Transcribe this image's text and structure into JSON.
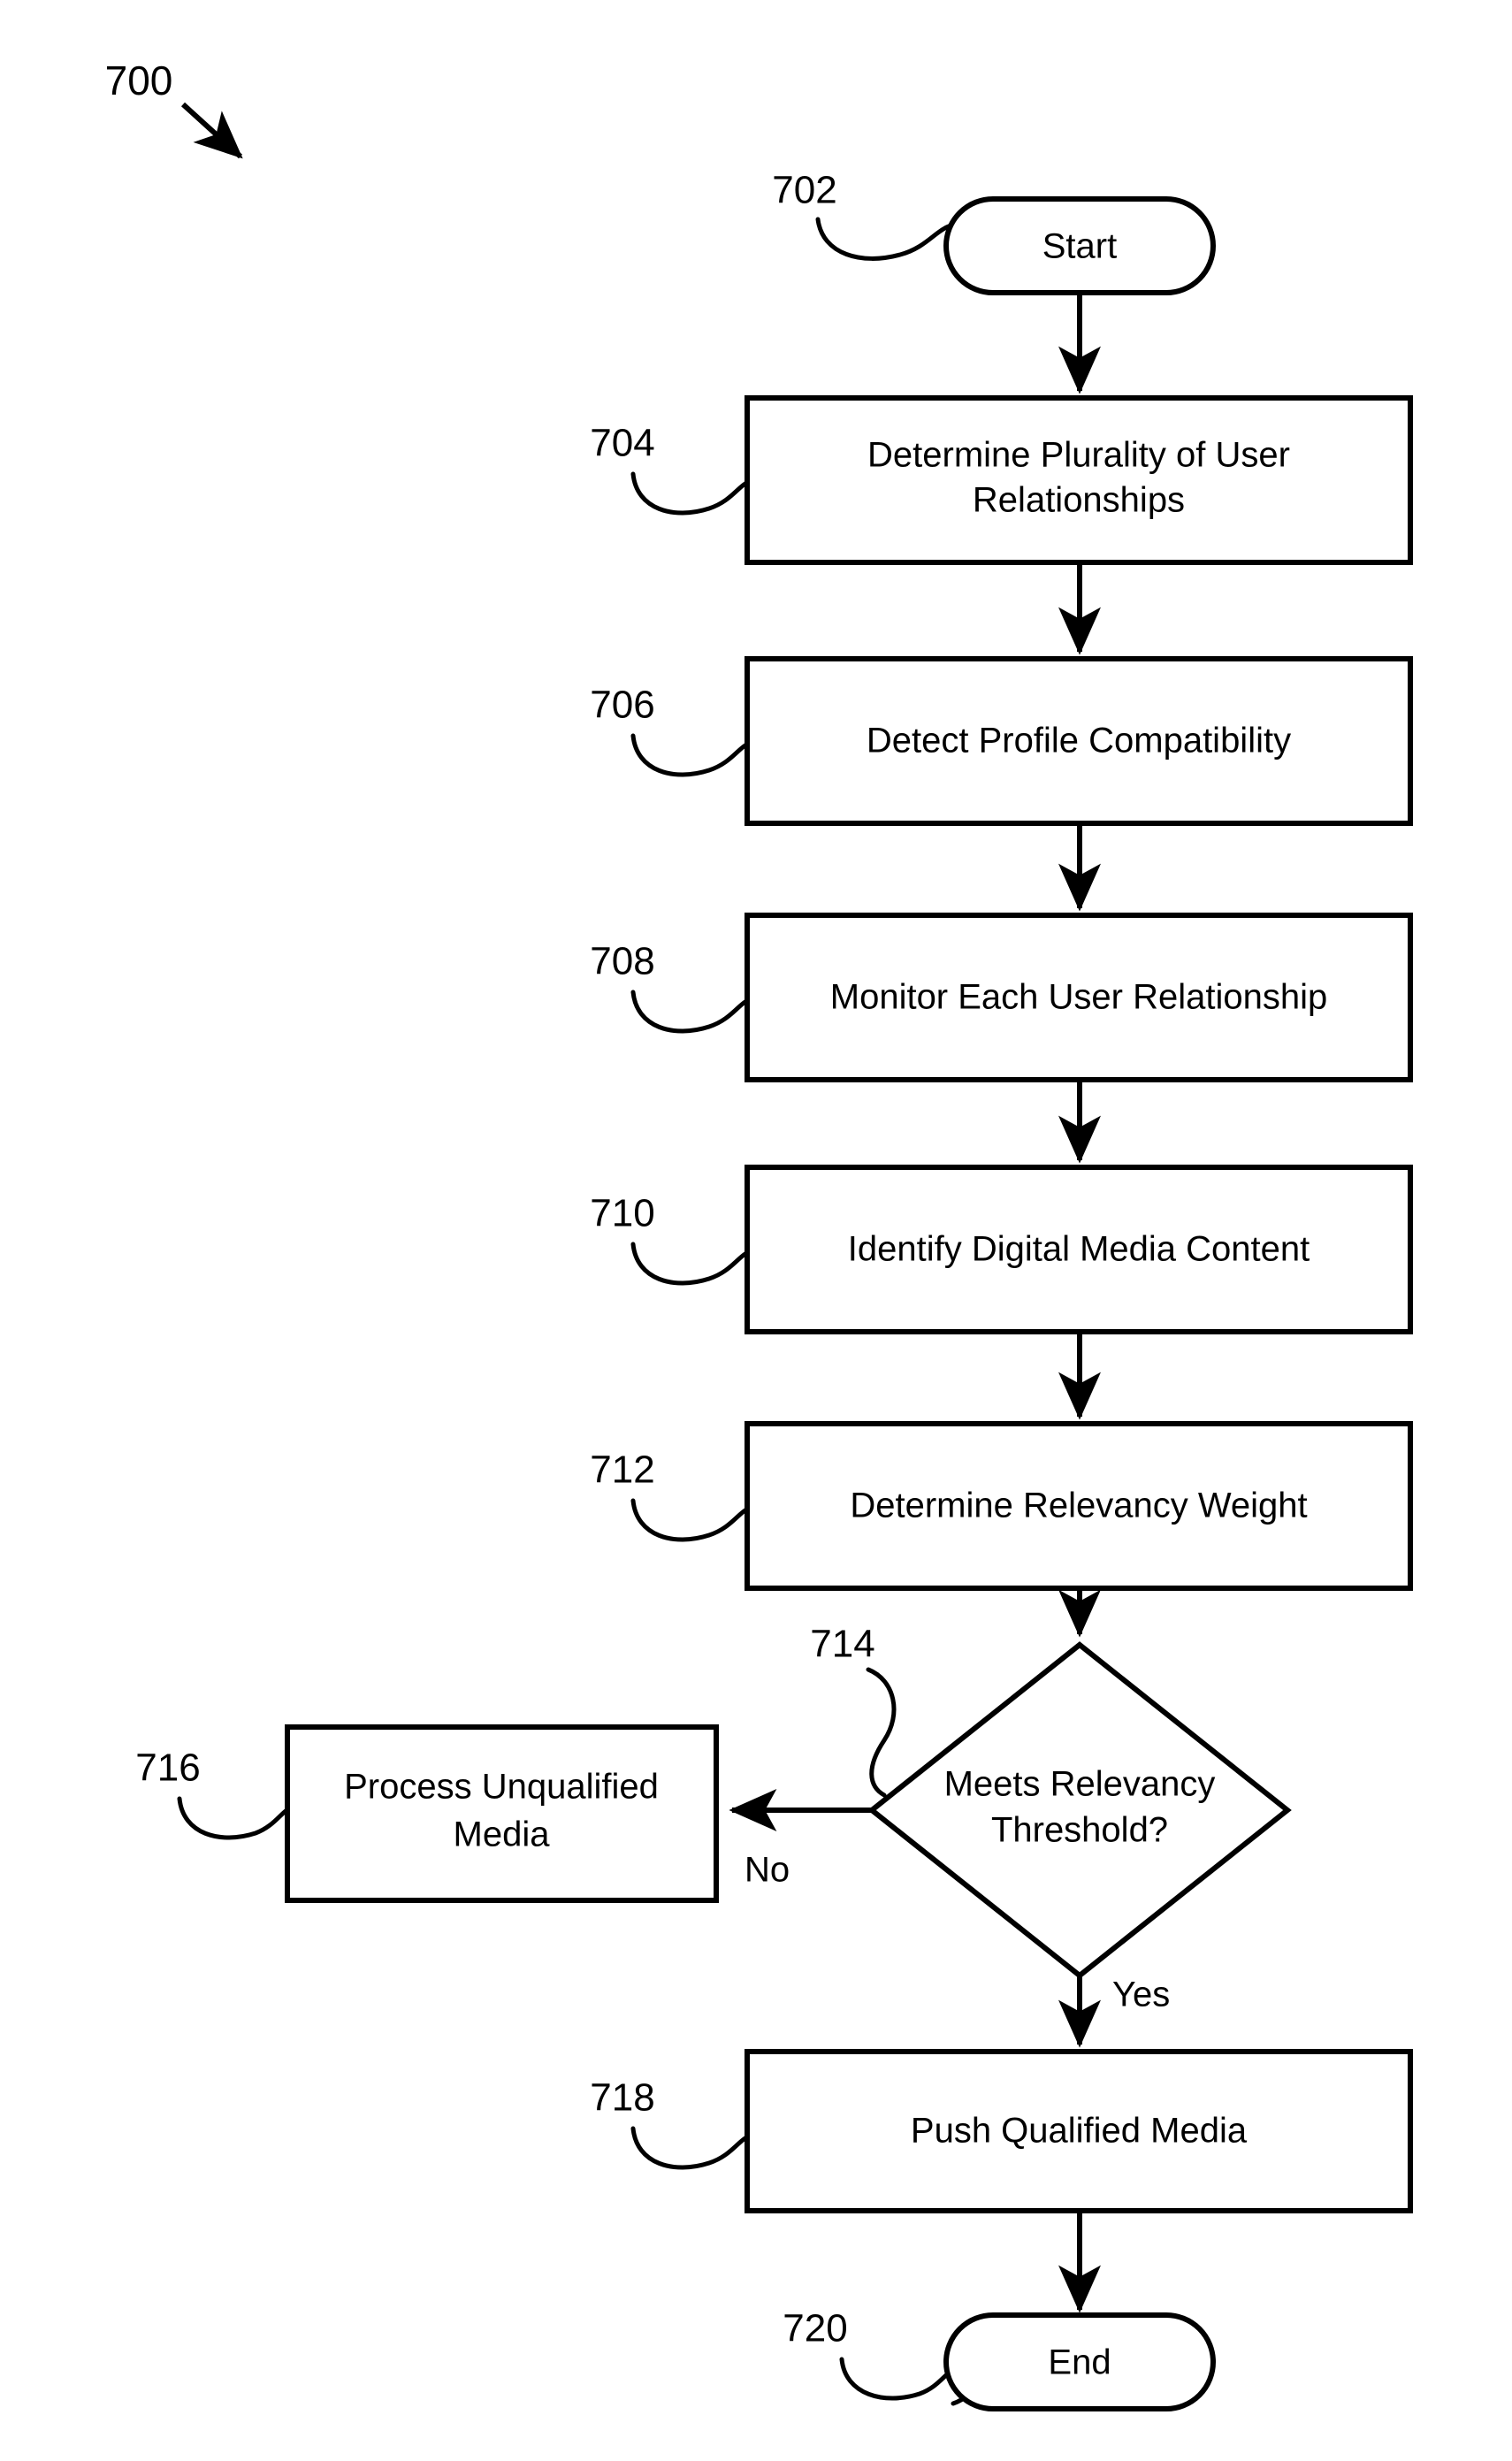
{
  "figure": {
    "number": "700",
    "type": "flowchart"
  },
  "nodes": {
    "start": {
      "ref": "702",
      "label": "Start",
      "shape": "terminator"
    },
    "determine_relationships": {
      "ref": "704",
      "line1": "Determine Plurality of User",
      "line2": "Relationships",
      "shape": "process"
    },
    "detect_compatibility": {
      "ref": "706",
      "label": "Detect Profile Compatibility",
      "shape": "process"
    },
    "monitor_relationship": {
      "ref": "708",
      "label": "Monitor Each User Relationship",
      "shape": "process"
    },
    "identify_media": {
      "ref": "710",
      "label": "Identify Digital Media Content",
      "shape": "process"
    },
    "determine_weight": {
      "ref": "712",
      "label": "Determine Relevancy Weight",
      "shape": "process"
    },
    "relevancy_decision": {
      "ref": "714",
      "line1": "Meets Relevancy",
      "line2": "Threshold?",
      "shape": "decision"
    },
    "process_unqualified": {
      "ref": "716",
      "line1": "Process Unqualified",
      "line2": "Media",
      "shape": "process"
    },
    "push_qualified": {
      "ref": "718",
      "label": "Push Qualified Media",
      "shape": "process"
    },
    "end": {
      "ref": "720",
      "label": "End",
      "shape": "terminator"
    }
  },
  "edge_labels": {
    "no": "No",
    "yes": "Yes"
  },
  "colors": {
    "stroke": "#000000",
    "fill": "#ffffff",
    "text": "#000000"
  }
}
